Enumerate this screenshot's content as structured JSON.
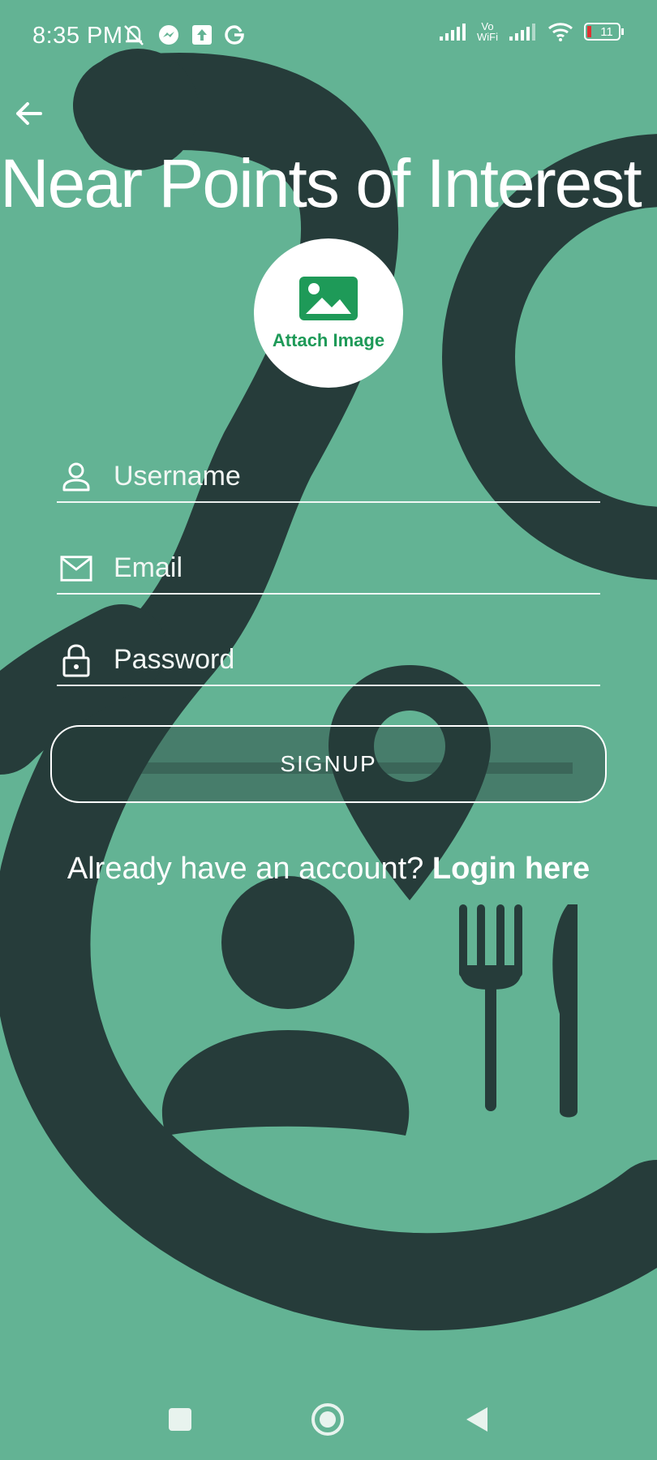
{
  "status_bar": {
    "time": "8:35 PM",
    "left_icons": [
      "muted-bell-icon",
      "messenger-icon",
      "upload-icon",
      "google-icon"
    ],
    "right_icons": [
      "signal-icon",
      "vowifi-icon",
      "signal-icon",
      "wifi-icon",
      "battery-icon"
    ],
    "vowifi_top": "Vo",
    "vowifi_bottom": "WiFi",
    "battery_level": "11"
  },
  "header": {
    "back_icon": "arrow-left-icon",
    "title": "Near Points of Interest"
  },
  "attach": {
    "icon": "image-icon",
    "label": "Attach Image",
    "icon_color": "#1e9a58"
  },
  "form": {
    "username": {
      "icon": "user-icon",
      "placeholder": "Username",
      "value": ""
    },
    "email": {
      "icon": "mail-icon",
      "placeholder": "Email",
      "value": ""
    },
    "password": {
      "icon": "lock-icon",
      "placeholder": "Password",
      "value": ""
    },
    "signup_label": "SIGNUP"
  },
  "login_prompt": {
    "text": "Already have an account?",
    "link": "Login here"
  },
  "nav_bar": {
    "buttons": [
      "recents-square-icon",
      "home-circle-icon",
      "back-triangle-icon"
    ]
  },
  "colors": {
    "background": "#63b394",
    "dark_shapes": "#263c3a",
    "accent": "#1e9a58",
    "text": "#ffffff"
  }
}
